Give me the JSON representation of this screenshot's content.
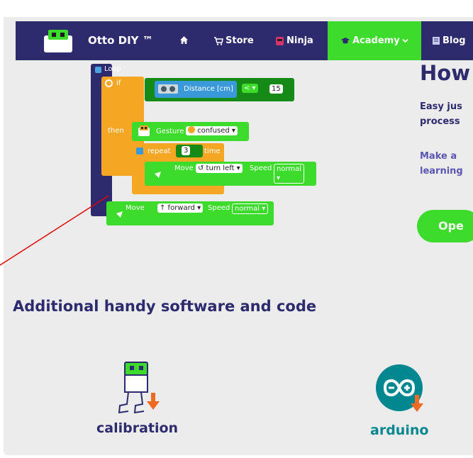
{
  "nav": {
    "brand": "Otto DIY ™",
    "items": [
      {
        "label": "Store",
        "icon": "cart-icon"
      },
      {
        "label": "Ninja",
        "icon": "ninja-icon"
      },
      {
        "label": "Academy",
        "icon": "graduation-cap-icon"
      },
      {
        "label": "Blog",
        "icon": "blog-icon"
      }
    ],
    "home_icon": "home-icon",
    "colors": {
      "bar": "#2d2a6e",
      "active": "#3ddb2c"
    }
  },
  "blocks": {
    "loop": "Loop",
    "if": "if",
    "distance": "Distance [cm]",
    "operator": "< ▾",
    "distance_value": "15",
    "then": "then",
    "gesture": "Gesture",
    "gesture_value": "confused ▾",
    "repeat": "repeat",
    "repeat_value": "3",
    "time": "time",
    "move1": "Move",
    "move1_dir": "↺ turn left ▾",
    "speed1": "Speed",
    "speed1_value": "normal ▾",
    "move2": "Move",
    "move2_dir": "↑ forward ▾",
    "speed2": "Speed",
    "speed2_value": "normal ▾"
  },
  "main": {
    "heading": "How",
    "desc1_line1": "Easy jus",
    "desc1_line2": "process",
    "desc2_line1": "Make a",
    "desc2_line2": "learning",
    "open_button": "Ope"
  },
  "section": {
    "title": "Additional handy software and code",
    "tools": [
      {
        "label": "calibration",
        "icon": "calibration-robot-icon"
      },
      {
        "label": "arduino",
        "icon": "arduino-logo-icon"
      }
    ]
  }
}
